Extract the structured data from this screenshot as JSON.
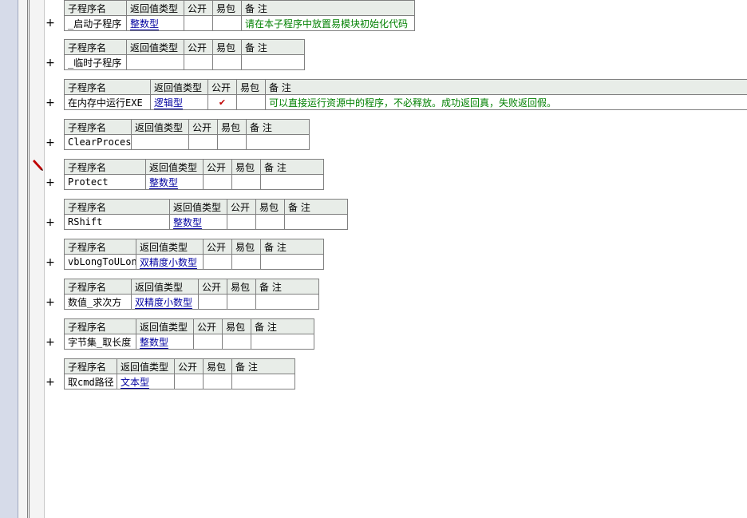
{
  "headers": {
    "name": "子程序名",
    "return_type": "返回值类型",
    "public": "公开",
    "easy_pack": "易包",
    "remark": "备 注"
  },
  "expand_symbol": "+",
  "public_mark": "✔",
  "subroutines": [
    {
      "name": "_启动子程序",
      "return_type": "整数型",
      "public": "",
      "easy_pack": "",
      "remark": "请在本子程序中放置易模块初始化代码"
    },
    {
      "name": "_临时子程序",
      "return_type": "",
      "public": "",
      "easy_pack": "",
      "remark": ""
    },
    {
      "name": "在内存中运行EXE",
      "return_type": "逻辑型",
      "public": "✔",
      "easy_pack": "",
      "remark": "可以直接运行资源中的程序，不必释放。成功返回真，失败返回假。"
    },
    {
      "name": "ClearProcess",
      "return_type": "",
      "public": "",
      "easy_pack": "",
      "remark": ""
    },
    {
      "name": "Protect",
      "return_type": "整数型",
      "public": "",
      "easy_pack": "",
      "remark": ""
    },
    {
      "name": "RShift",
      "return_type": "整数型",
      "public": "",
      "easy_pack": "",
      "remark": ""
    },
    {
      "name": "vbLongToULong",
      "return_type": "双精度小数型",
      "public": "",
      "easy_pack": "",
      "remark": ""
    },
    {
      "name": "数值_求次方",
      "return_type": "双精度小数型",
      "public": "",
      "easy_pack": "",
      "remark": ""
    },
    {
      "name": "字节集_取长度",
      "return_type": "整数型",
      "public": "",
      "easy_pack": "",
      "remark": ""
    },
    {
      "name": "取cmd路径",
      "return_type": "文本型",
      "public": "",
      "easy_pack": "",
      "remark": ""
    }
  ]
}
